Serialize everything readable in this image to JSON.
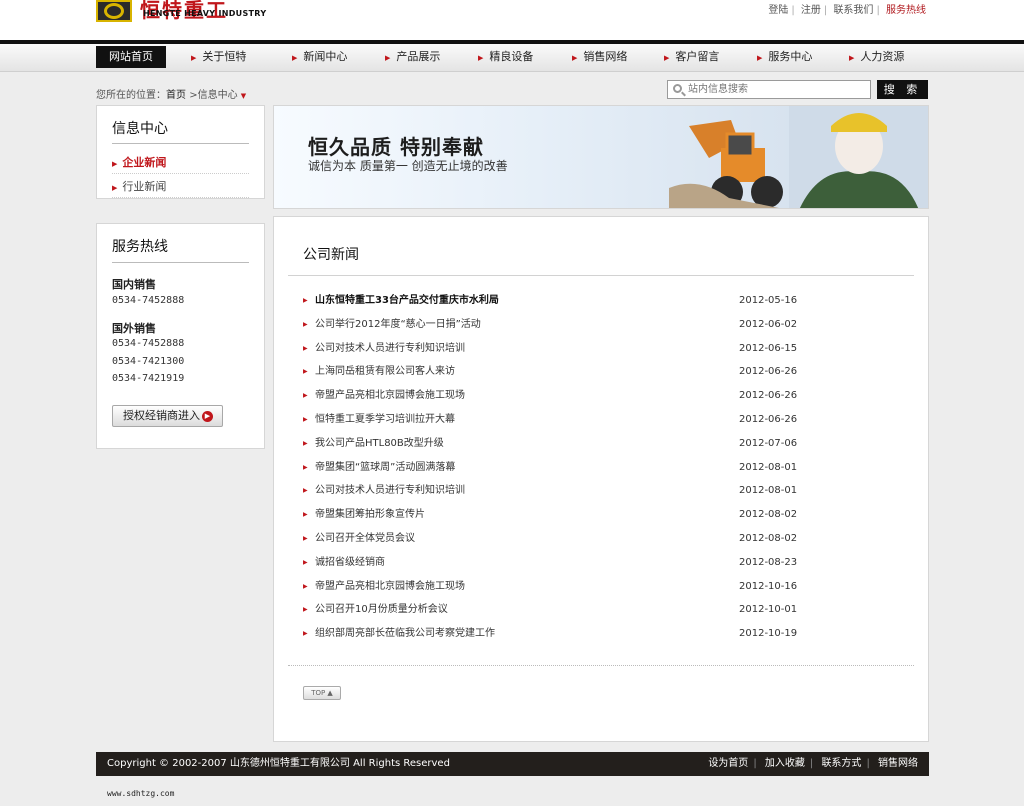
{
  "header": {
    "logo_cn": "恒特重工",
    "logo_en": "HENGTE HEAVY INDUSTRY",
    "toplinks": [
      "登陆",
      "注册",
      "联系我们"
    ],
    "hotline_link": "服务热线"
  },
  "nav": {
    "items": [
      "网站首页",
      "关于恒特",
      "新闻中心",
      "产品展示",
      "精良设备",
      "销售网络",
      "客户留言",
      "服务中心",
      "人力资源"
    ]
  },
  "breadcrumb": {
    "prefix": "您所在的位置：",
    "home": "首页",
    "current": ">信息中心"
  },
  "search": {
    "placeholder": "站内信息搜索",
    "button": "搜 索"
  },
  "sidebar": {
    "info_title": "信息中心",
    "info_links": [
      "企业新闻",
      "行业新闻"
    ],
    "hotline_title": "服务热线",
    "domestic_label": "国内销售",
    "domestic_numbers": [
      "0534-7452888"
    ],
    "foreign_label": "国外销售",
    "foreign_numbers": [
      "0534-7452888",
      "0534-7421300",
      "0534-7421919"
    ],
    "dealer_button": "授权经销商进入"
  },
  "banner": {
    "slogan": "恒久品质 特别奉献",
    "subtitle": "诚信为本 质量第一 创造无止境的改善"
  },
  "news": {
    "heading": "公司新闻",
    "items": [
      {
        "title": "山东恒特重工33台产品交付重庆市水利局",
        "date": "2012-05-16",
        "bold": true
      },
      {
        "title": "公司举行2012年度“慈心一日捐”活动",
        "date": "2012-06-02",
        "bold": false
      },
      {
        "title": "公司对技术人员进行专利知识培训",
        "date": "2012-06-15",
        "bold": false
      },
      {
        "title": "上海同岳租赁有限公司客人来访",
        "date": "2012-06-26",
        "bold": false
      },
      {
        "title": "帝盟产品亮相北京园博会施工现场",
        "date": "2012-06-26",
        "bold": false
      },
      {
        "title": "恒特重工夏季学习培训拉开大幕",
        "date": "2012-06-26",
        "bold": false
      },
      {
        "title": "我公司产品HTL80B改型升级",
        "date": "2012-07-06",
        "bold": false
      },
      {
        "title": "帝盟集团“篮球周”活动圆满落幕",
        "date": "2012-08-01",
        "bold": false
      },
      {
        "title": "公司对技术人员进行专利知识培训",
        "date": "2012-08-01",
        "bold": false
      },
      {
        "title": "帝盟集团筹拍形象宣传片",
        "date": "2012-08-02",
        "bold": false
      },
      {
        "title": "公司召开全体党员会议",
        "date": "2012-08-02",
        "bold": false
      },
      {
        "title": "诚招省级经销商",
        "date": "2012-08-23",
        "bold": false
      },
      {
        "title": "帝盟产品亮相北京园博会施工现场",
        "date": "2012-10-16",
        "bold": false
      },
      {
        "title": "公司召开10月份质量分析会议",
        "date": "2012-10-01",
        "bold": false
      },
      {
        "title": "组织部周亮部长莅临我公司考察党建工作",
        "date": "2012-10-19",
        "bold": false
      }
    ],
    "top_button": "TOP ▲"
  },
  "footer": {
    "copyright": "Copyright © 2002-2007 山东德州恒特重工有限公司 All Rights Reserved",
    "links": [
      "设为首页",
      "加入收藏",
      "联系方式",
      "销售网络"
    ]
  },
  "url": "www.sdhtzg.com",
  "colors": {
    "accent": "#c0161b",
    "dark": "#111111",
    "footer_bg": "#231f1c"
  }
}
